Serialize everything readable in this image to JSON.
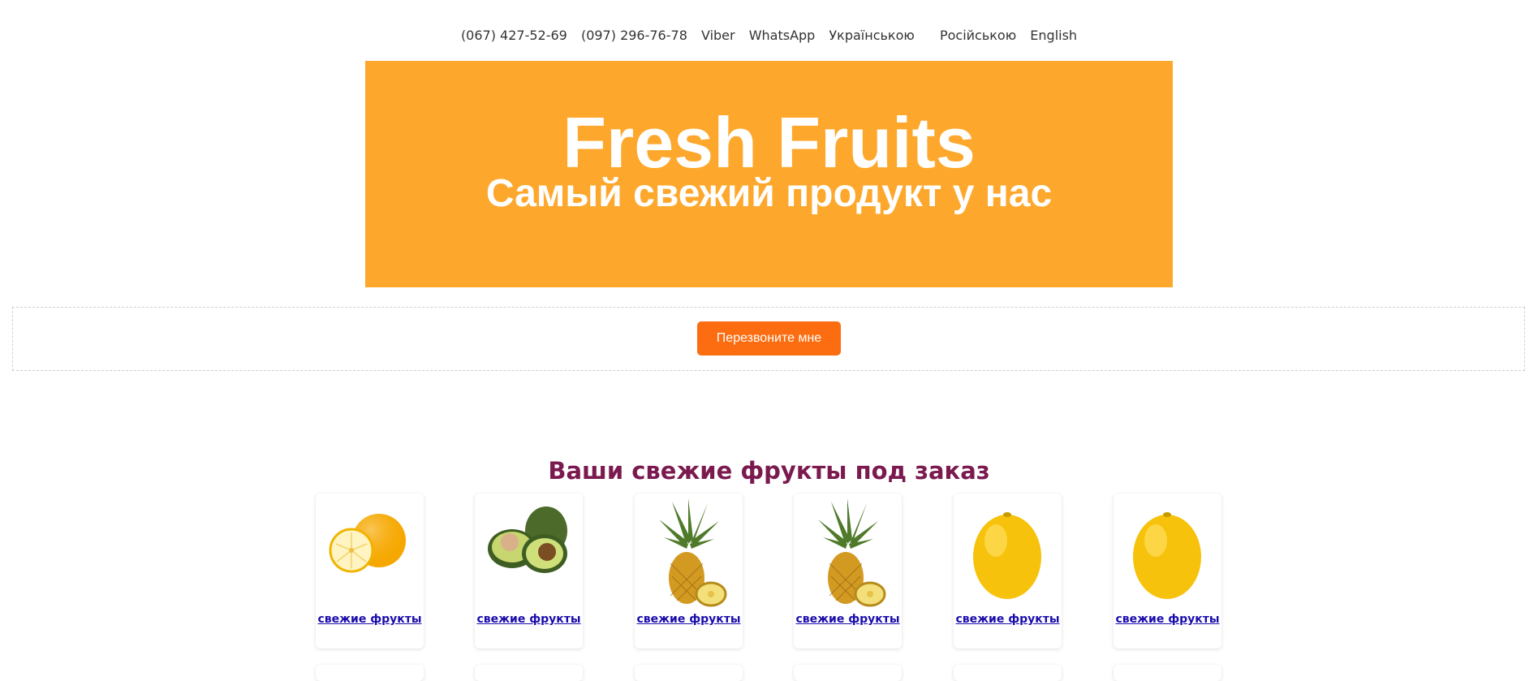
{
  "topnav": {
    "phone1": "(067) 427-52-69",
    "phone2": "(097) 296-76-78",
    "viber": "Viber",
    "whatsapp": "WhatsApp",
    "lang_uk": "Українською",
    "lang_ru": "Російською",
    "lang_en": "English"
  },
  "banner": {
    "title": "Fresh Fruits",
    "subtitle": "Самый свежий продукт у нас",
    "bg_color": "#fda82d"
  },
  "callback": {
    "button_label": "Перезвоните мне",
    "button_color": "#fb6d10"
  },
  "products_section": {
    "title": "Ваши свежие фрукты под заказ",
    "title_color": "#7b1a4f",
    "items": [
      {
        "link": "свежие фрукты",
        "fruit": "orange-icon"
      },
      {
        "link": "свежие фрукты",
        "fruit": "avocado-icon"
      },
      {
        "link": "свежие фрукты",
        "fruit": "pineapple-icon"
      },
      {
        "link": "свежие фрукты",
        "fruit": "pineapple-icon"
      },
      {
        "link": "свежие фрукты",
        "fruit": "lemon-icon"
      },
      {
        "link": "свежие фрукты",
        "fruit": "lemon-icon"
      }
    ]
  }
}
